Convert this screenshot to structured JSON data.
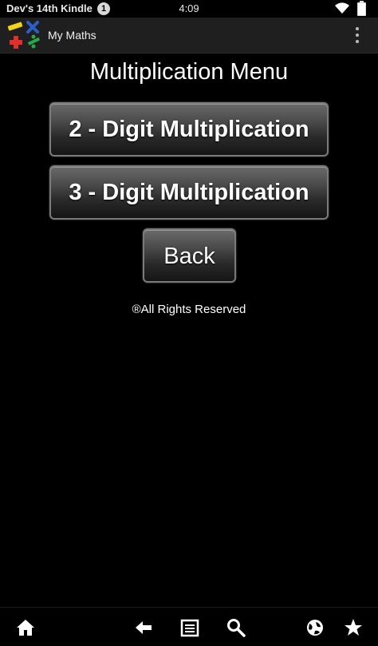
{
  "status_bar": {
    "device_name": "Dev's 14th Kindle",
    "notification_count": "1",
    "time": "4:09",
    "icons": [
      "wifi-icon",
      "battery-icon"
    ]
  },
  "action_bar": {
    "app_icon": "my-maths-app-icon",
    "title": "My Maths",
    "overflow_icon": "overflow-menu-icon"
  },
  "main": {
    "title": "Multiplication Menu",
    "buttons": [
      {
        "label": "2 - Digit Multiplication"
      },
      {
        "label": "3 - Digit Multiplication"
      },
      {
        "label": "Back"
      }
    ],
    "copyright": "®All Rights Reserved"
  },
  "nav_bar": {
    "icons": [
      "home-icon",
      "back-arrow-icon",
      "menu-list-icon",
      "search-icon",
      "web-browser-icon",
      "favorites-star-icon"
    ]
  },
  "colors": {
    "background": "#000000",
    "action_bar": "#1f1f1f",
    "button_border": "#7a7a7a",
    "app_icon_yellow": "#f2d21b",
    "app_icon_blue": "#2b5fc7",
    "app_icon_red": "#e0302a",
    "app_icon_green": "#2aa84a"
  }
}
